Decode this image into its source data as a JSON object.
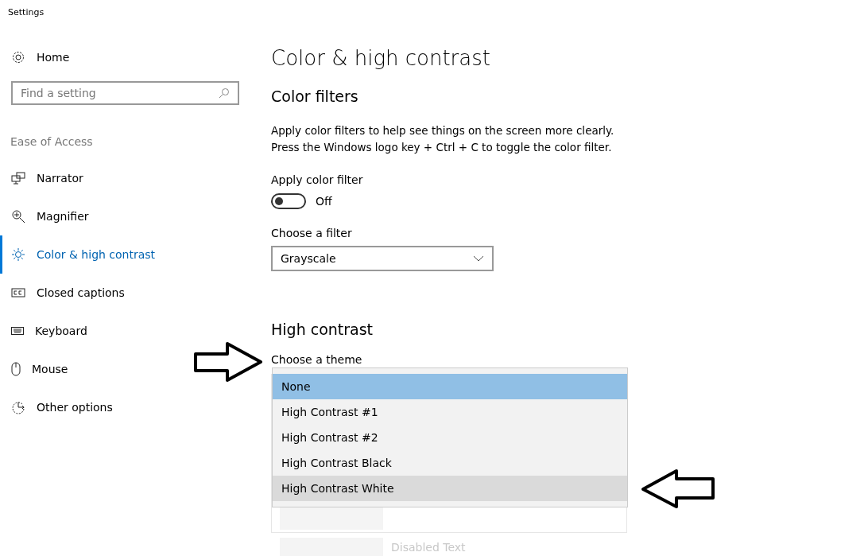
{
  "window": {
    "title": "Settings"
  },
  "sidebar": {
    "home": "Home",
    "search": {
      "placeholder": "Find a setting"
    },
    "section": "Ease of Access",
    "items": [
      {
        "label": "Narrator",
        "selected": false
      },
      {
        "label": "Magnifier",
        "selected": false
      },
      {
        "label": "Color & high contrast",
        "selected": true
      },
      {
        "label": "Closed captions",
        "selected": false
      },
      {
        "label": "Keyboard",
        "selected": false
      },
      {
        "label": "Mouse",
        "selected": false
      },
      {
        "label": "Other options",
        "selected": false
      }
    ]
  },
  "content": {
    "title": "Color & high contrast",
    "color_filters": {
      "heading": "Color filters",
      "description": [
        "Apply color filters to help see things on the screen more clearly.",
        "Press the Windows logo key + Ctrl + C to toggle the color filter."
      ],
      "toggle": {
        "label": "Apply color filter",
        "on": false,
        "state_text": "Off"
      },
      "filter": {
        "label": "Choose a filter",
        "value": "Grayscale"
      }
    },
    "high_contrast": {
      "heading": "High contrast",
      "theme_label": "Choose a theme",
      "options": [
        {
          "label": "None",
          "selected": true,
          "hovered": false
        },
        {
          "label": "High Contrast #1",
          "selected": false,
          "hovered": false
        },
        {
          "label": "High Contrast #2",
          "selected": false,
          "hovered": false
        },
        {
          "label": "High Contrast Black",
          "selected": false,
          "hovered": false
        },
        {
          "label": "High Contrast White",
          "selected": false,
          "hovered": true
        }
      ],
      "preview_label": "Disabled Text"
    }
  }
}
